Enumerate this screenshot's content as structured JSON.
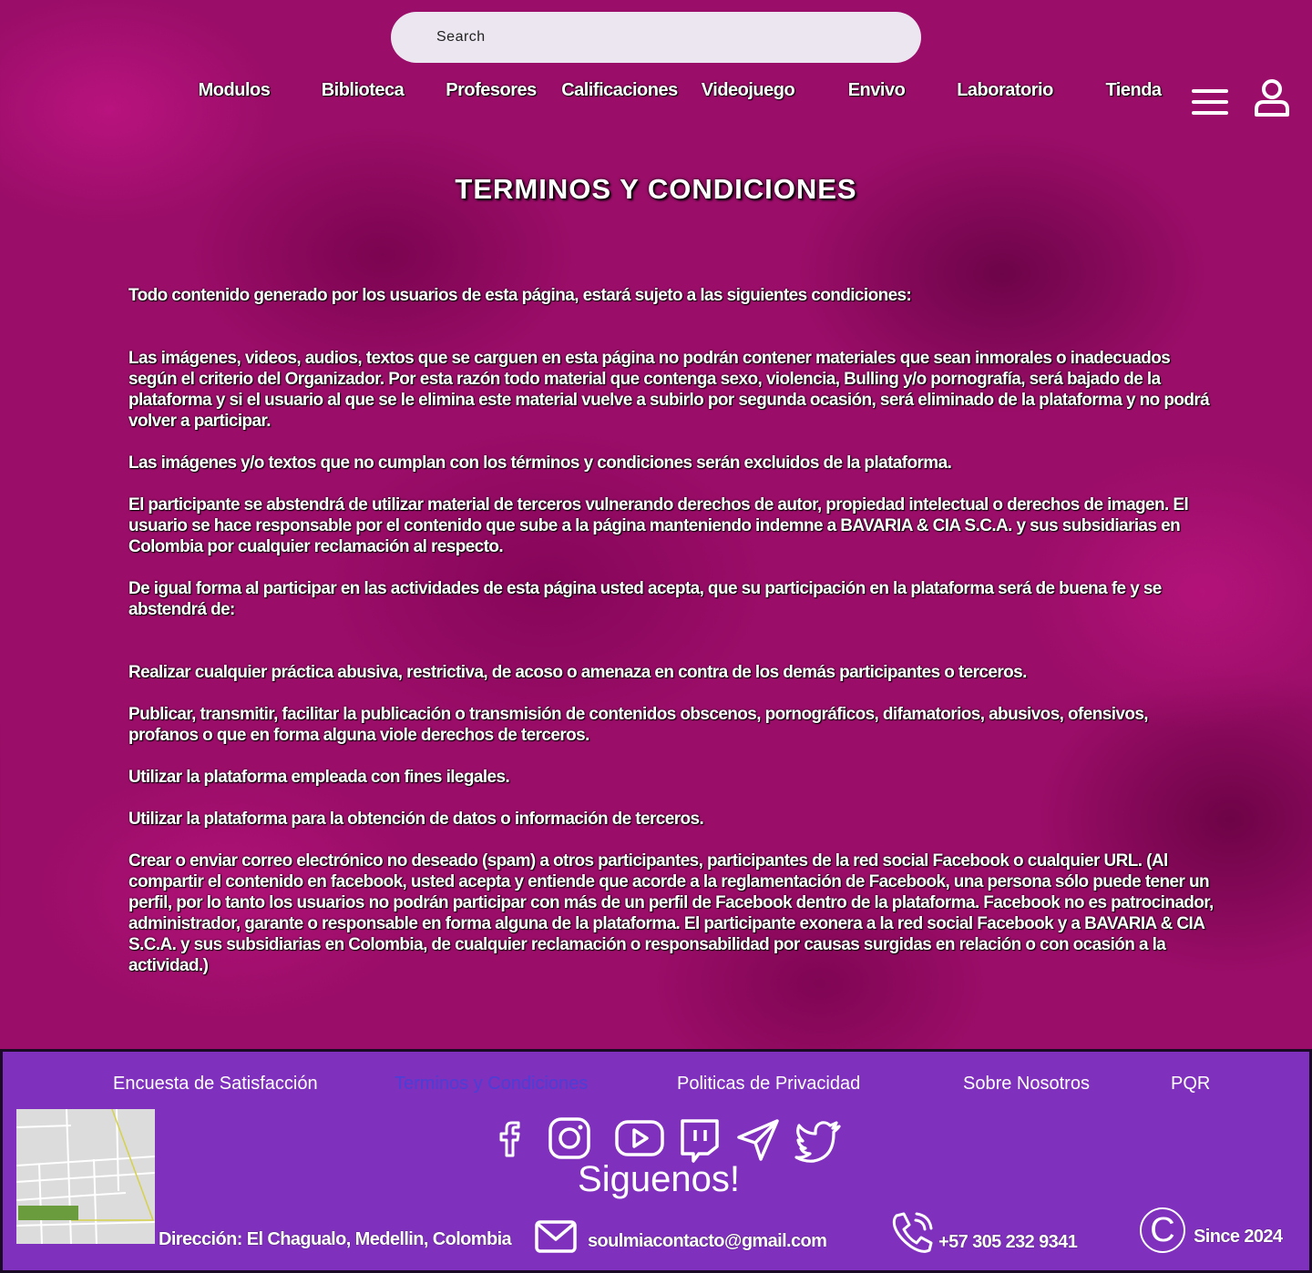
{
  "search": {
    "placeholder": "Search"
  },
  "nav": {
    "items": [
      "Modulos",
      "Biblioteca",
      "Profesores",
      "Calificaciones",
      "Videojuego",
      "Envivo",
      "Laboratorio",
      "Tienda"
    ]
  },
  "page": {
    "title": "TERMINOS Y CONDICIONES"
  },
  "content": {
    "paragraphs": [
      "Todo contenido generado por los usuarios de esta página, estará sujeto a las siguientes condiciones:",
      "Las imágenes, videos, audios, textos que se carguen en esta página no podrán contener materiales que sean inmorales o inadecuados según el criterio del Organizador. Por esta razón todo material que contenga sexo, violencia, Bulling y/o pornografía, será bajado de la plataforma y si el usuario al que se le elimina este material vuelve a subirlo por segunda ocasión, será eliminado de la plataforma y no podrá volver a participar.",
      "Las imágenes y/o textos que no cumplan con los términos y condiciones serán excluidos de la plataforma.",
      "El participante se abstendrá de utilizar material de terceros vulnerando derechos de autor, propiedad intelectual o derechos de imagen. El usuario se hace responsable por el contenido que sube a la página manteniendo indemne a BAVARIA & CIA S.C.A. y sus subsidiarias en Colombia por cualquier reclamación al respecto.",
      "De igual forma al participar en las actividades de esta página usted acepta, que su participación en la plataforma será de buena fe y se abstendrá de:",
      "Realizar cualquier práctica abusiva, restrictiva, de acoso o amenaza en contra de los demás participantes o terceros.",
      "Publicar, transmitir, facilitar la publicación o transmisión de contenidos obscenos, pornográficos, difamatorios, abusivos, ofensivos, profanos o que en forma alguna viole derechos de terceros.",
      "Utilizar la plataforma empleada con fines ilegales.",
      "Utilizar la plataforma para la obtención de datos o información de terceros.",
      "Crear o enviar correo electrónico no deseado (spam) a otros participantes, participantes de la red social Facebook o cualquier URL. (Al compartir el contenido en facebook, usted acepta y entiende que acorde a la reglamentación de Facebook, una persona sólo puede tener un perfil, por lo tanto los usuarios no podrán participar con más de un perfil de Facebook dentro de la plataforma. Facebook no es patrocinador, administrador, garante o responsable en forma alguna de la plataforma. El participante exonera a la red social Facebook y a BAVARIA & CIA S.C.A. y sus subsidiarias en Colombia,  de cualquier reclamación o responsabilidad por causas surgidas en relación o con ocasión a la actividad.)"
    ]
  },
  "footer": {
    "links": [
      "Encuesta de Satisfacción",
      "Terminos y Condiciones",
      "Politicas de Privacidad",
      "Sobre Nosotros",
      "PQR"
    ],
    "active_link_color": "#4a3fd6",
    "background_color": "#7f30bc",
    "social_icons": [
      "facebook-icon",
      "instagram-icon",
      "youtube-icon",
      "twitch-icon",
      "telegram-icon",
      "twitter-icon"
    ],
    "follow_label": "Siguenos!",
    "address": "Dirección: El Chagualo, Medellin, Colombia",
    "email": "soulmiacontacto@gmail.com",
    "phone": "+57 305 232 9341",
    "copyright_symbol": "C",
    "since": "Since 2024"
  }
}
